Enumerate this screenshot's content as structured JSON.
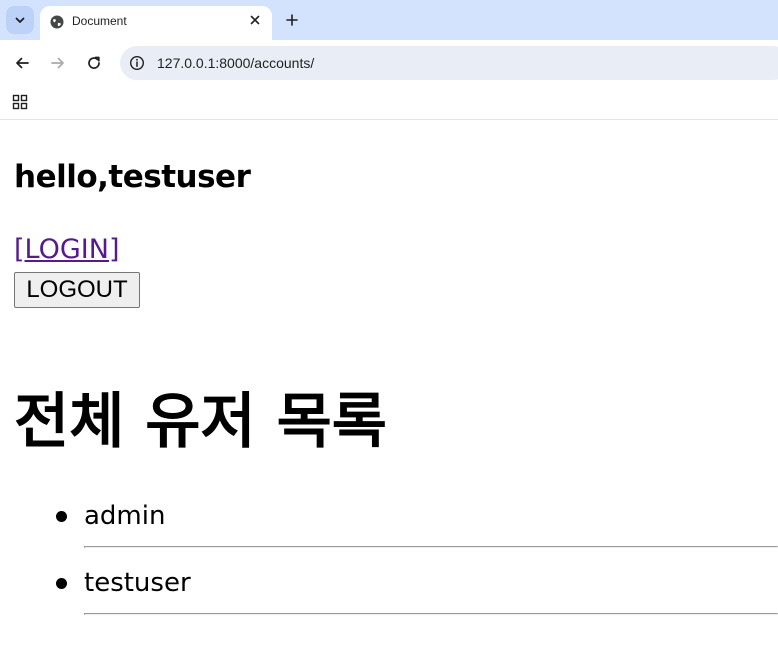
{
  "browser": {
    "tab_title": "Document",
    "url": "127.0.0.1:8000/accounts/",
    "icons": {
      "tab_search": "chevron-down-icon",
      "favicon": "globe-icon",
      "close": "close-icon",
      "new_tab": "plus-icon",
      "back": "back-arrow-icon",
      "forward": "forward-arrow-icon",
      "reload": "reload-icon",
      "site_info": "info-icon",
      "apps": "apps-grid-icon"
    },
    "colors": {
      "tabstrip": "#d3e3fd",
      "omnibox": "#e9eef6"
    }
  },
  "page": {
    "greeting": "hello,testuser",
    "login_link": "[LOGIN]",
    "logout_button": "LOGOUT",
    "list_heading": "전체 유저 목록",
    "users": [
      "admin",
      "testuser"
    ],
    "colors": {
      "visited_link": "#551a8b"
    }
  }
}
